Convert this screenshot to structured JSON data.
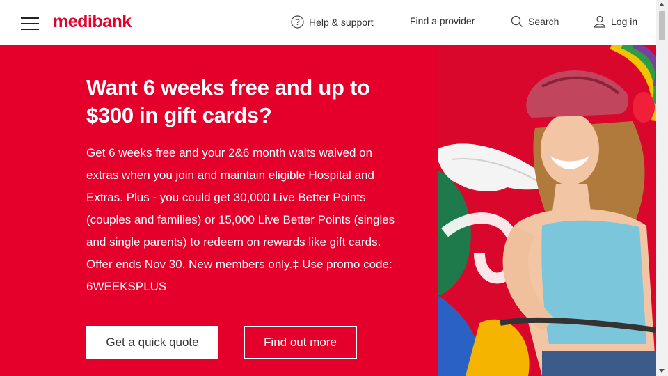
{
  "header": {
    "logo": "medibank",
    "nav": {
      "help": "Help & support",
      "provider": "Find a provider",
      "search": "Search",
      "login": "Log in"
    }
  },
  "hero": {
    "title": "Want 6 weeks free and up to $300 in gift cards?",
    "body": "Get 6 weeks free and your 2&6 month waits waived on extras when you join and maintain eligible Hospital and Extras. Plus - you could get 30,000 Live Better Points (couples and families) or 15,000 Live Better Points (singles and single parents) to redeem on rewards like gift cards. Offer ends Nov 30. New members only.‡ Use promo code: 6WEEKSPLUS",
    "primary_button": "Get a quick quote",
    "secondary_button": "Find out more"
  },
  "colors": {
    "brand_red": "#e4002b",
    "text_dark": "#333333"
  },
  "icons": {
    "menu": "hamburger-menu-icon",
    "help": "question-circle-icon",
    "search": "magnifier-icon",
    "login": "user-icon"
  }
}
